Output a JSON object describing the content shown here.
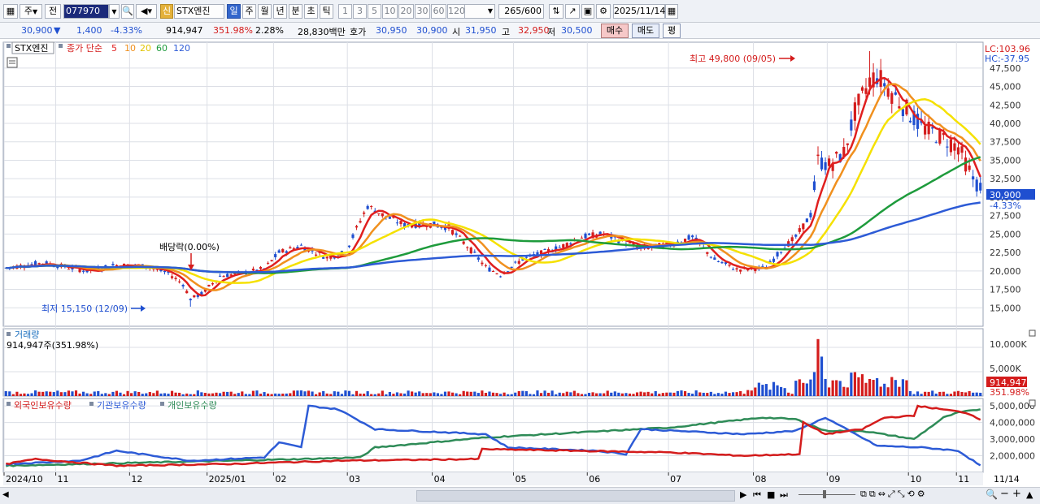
{
  "toolbar": {
    "period_mode": "주",
    "prev_label": "전",
    "stock_code": "077970",
    "new_badge": "신",
    "stock_name": "STX엔진",
    "periods": [
      "일",
      "주",
      "월",
      "년",
      "분",
      "초",
      "틱"
    ],
    "active_period": "일",
    "intervals": [
      "1",
      "3",
      "5",
      "10",
      "20",
      "30",
      "60",
      "120"
    ],
    "count": "265",
    "count_total": "/600",
    "date": "2025/11/14"
  },
  "quote": {
    "price": "30,900",
    "change_arrow": "▼",
    "change": "1,400",
    "change_pct": "-4.33%",
    "volume": "914,947",
    "volume_ratio": "351.98%",
    "turnover": "2.28%",
    "amount": "28,830백만",
    "bid_label": "호가",
    "ask": "30,950",
    "bid": "30,900",
    "open_label": "시",
    "open": "31,950",
    "high_label": "고",
    "high": "32,950",
    "low_label": "저",
    "low": "30,500",
    "buy_label": "매수",
    "sell_label": "매도",
    "eval_label": "평"
  },
  "price_panel": {
    "legend_name": "STX엔진",
    "legend_ma_prefix": "종가 단순",
    "ma_periods": [
      "5",
      "10",
      "20",
      "60",
      "120"
    ],
    "ma_colors": [
      "#e01f1f",
      "#f0901e",
      "#f5e100",
      "#1e9b3c",
      "#2d5bd6"
    ],
    "lc_label": "LC:103.96",
    "hc_label": "HC:-37.95",
    "y_ticks": [
      "47,500",
      "45,000",
      "42,500",
      "40,000",
      "37,500",
      "35,000",
      "32,500",
      "30,000",
      "27,500",
      "25,000",
      "22,500",
      "20,000",
      "17,500",
      "15,000"
    ],
    "current_price_tag": "30,900",
    "current_change_tag": "-4.33%",
    "annotation_high": "최고 49,800 (09/05)",
    "annotation_low": "최저 15,150 (12/09)",
    "annotation_dividend": "배당락(0.00%)"
  },
  "volume_panel": {
    "title": "거래량",
    "value_text": "914,947주(351.98%)",
    "y_ticks": [
      "10,000K",
      "5,000K"
    ],
    "current_tag": "914,947",
    "current_pct_tag": "351.98%"
  },
  "holdings_panel": {
    "legend": [
      {
        "label": "외국인보유수량",
        "color": "#d41c1c"
      },
      {
        "label": "기관보유수량",
        "color": "#2d5bd6"
      },
      {
        "label": "개인보유수량",
        "color": "#2e8b57"
      }
    ],
    "y_ticks": [
      "5,000,000",
      "4,000,000",
      "3,000,000",
      "2,000,000"
    ]
  },
  "x_axis": {
    "labels": [
      "2024/10",
      "11",
      "12",
      "2025/01",
      "02",
      "03",
      "04",
      "05",
      "06",
      "07",
      "08",
      "09",
      "10",
      "11"
    ],
    "right_label": "11/14"
  },
  "colors": {
    "up": "#d41c1c",
    "down": "#1f4fd0",
    "grid": "#dcdfe6",
    "accent": "#1b2a7a"
  }
}
